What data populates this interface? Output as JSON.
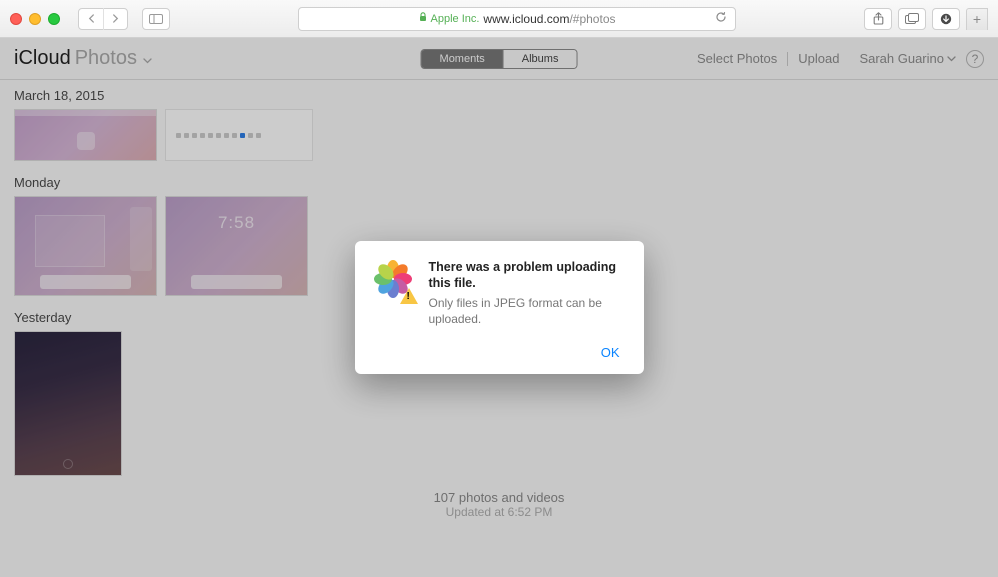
{
  "browser": {
    "address_prefix": "Apple Inc.",
    "address_main": "www.icloud.com",
    "address_path": "/#photos"
  },
  "header": {
    "brand": "iCloud",
    "section": "Photos",
    "tabs": {
      "moments": "Moments",
      "albums": "Albums"
    },
    "select_label": "Select Photos",
    "upload_label": "Upload",
    "user_name": "Sarah Guarino",
    "help": "?"
  },
  "sections": [
    {
      "title": "March 18, 2015"
    },
    {
      "title": "Monday"
    },
    {
      "title": "Yesterday"
    }
  ],
  "thumb3_time": "7:58",
  "footer": {
    "count_line": "107 photos and videos",
    "updated_line": "Updated at 6:52 PM"
  },
  "dialog": {
    "title": "There was a problem uploading this file.",
    "subtitle": "Only files in JPEG format can be uploaded.",
    "ok": "OK"
  }
}
